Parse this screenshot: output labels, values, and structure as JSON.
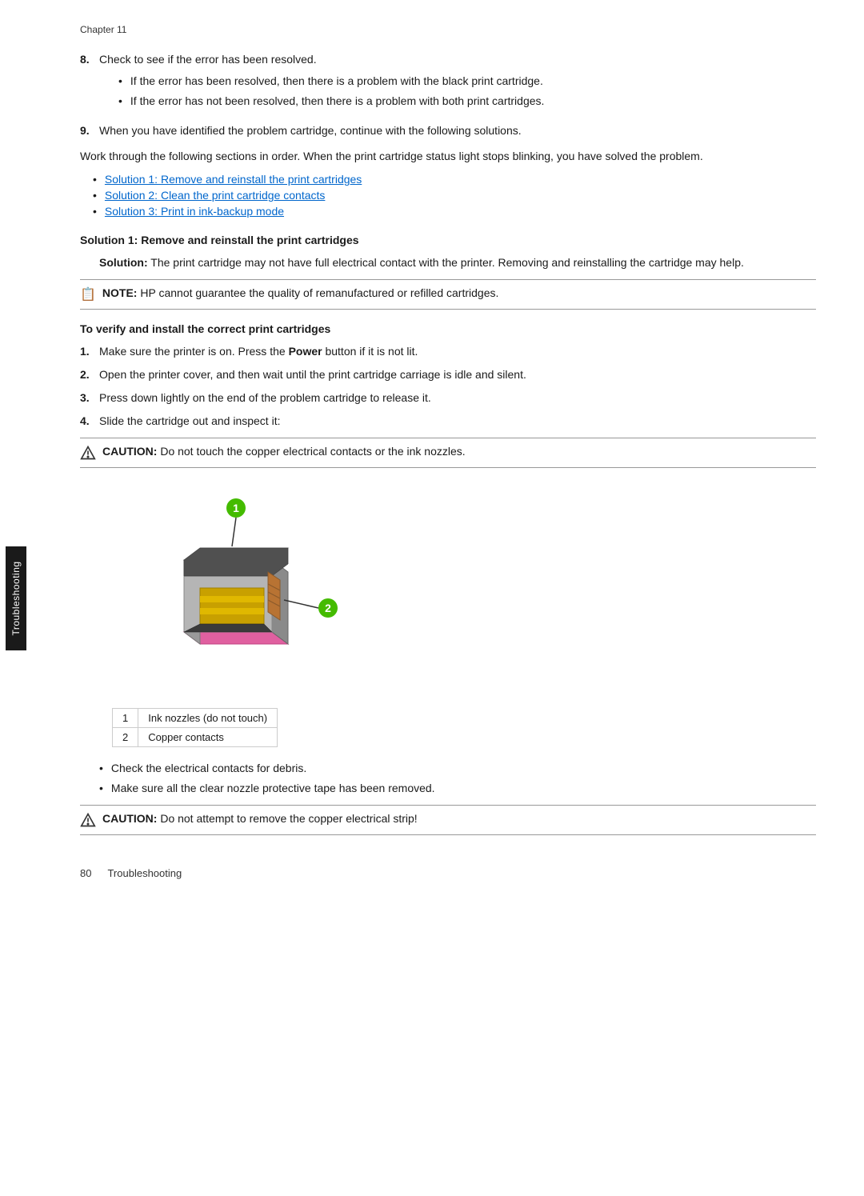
{
  "chapter": "Chapter 11",
  "step8": {
    "main": "Check to see if the error has been resolved.",
    "bullets": [
      "If the error has been resolved, then there is a problem with the black print cartridge.",
      "If the error has not been resolved, then there is a problem with both print cartridges."
    ]
  },
  "step9": {
    "main": "When you have identified the problem cartridge, continue with the following solutions."
  },
  "intro_para": "Work through the following sections in order. When the print cartridge status light stops blinking, you have solved the problem.",
  "links": [
    "Solution 1: Remove and reinstall the print cartridges",
    "Solution 2: Clean the print cartridge contacts",
    "Solution 3: Print in ink-backup mode"
  ],
  "section_heading": "Solution 1: Remove and reinstall the print cartridges",
  "solution_label": "Solution:",
  "solution_text": " The print cartridge may not have full electrical contact with the printer. Removing and reinstalling the cartridge may help.",
  "note_label": "NOTE:",
  "note_text": " HP cannot guarantee the quality of remanufactured or refilled cartridges.",
  "verify_heading": "To verify and install the correct print cartridges",
  "steps": [
    {
      "num": "1.",
      "text_before": "Make sure the printer is on. Press the ",
      "bold": "Power",
      "text_after": " button if it is not lit."
    },
    {
      "num": "2.",
      "text": "Open the printer cover, and then wait until the print cartridge carriage is idle and silent."
    },
    {
      "num": "3.",
      "text": "Press down lightly on the end of the problem cartridge to release it."
    },
    {
      "num": "4.",
      "text": "Slide the cartridge out and inspect it:"
    }
  ],
  "caution1_label": "CAUTION:",
  "caution1_text": " Do not touch the copper electrical contacts or the ink nozzles.",
  "cartridge_parts": [
    {
      "num": "1",
      "label": "Ink nozzles (do not touch)"
    },
    {
      "num": "2",
      "label": "Copper contacts"
    }
  ],
  "check_bullets": [
    "Check the electrical contacts for debris.",
    "Make sure all the clear nozzle protective tape has been removed."
  ],
  "caution2_label": "CAUTION:",
  "caution2_text": " Do not attempt to remove the copper electrical strip!",
  "footer": {
    "page_number": "80",
    "chapter_label": "Troubleshooting"
  },
  "side_tab": "Troubleshooting"
}
